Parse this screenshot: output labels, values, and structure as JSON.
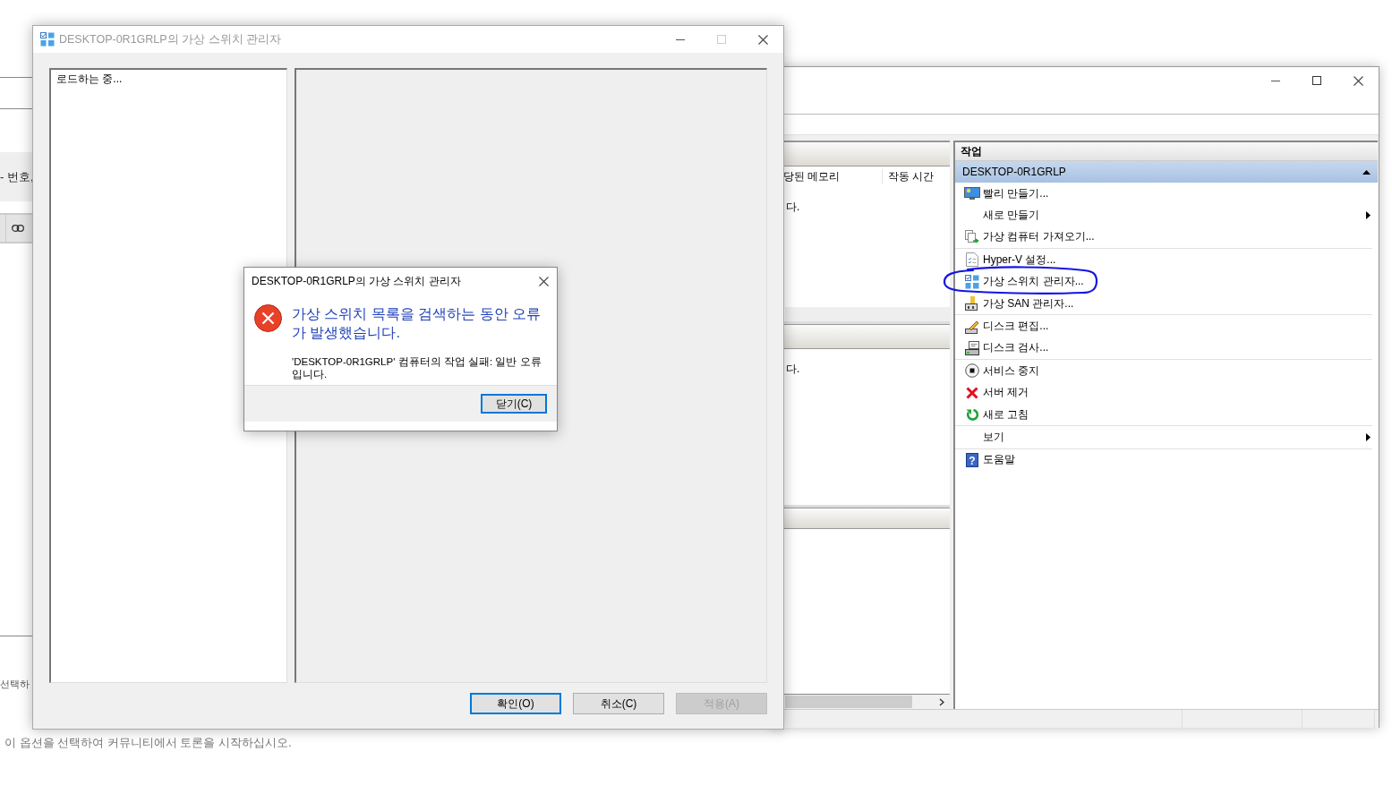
{
  "background_page": {
    "field_label": "- 번호,",
    "fragment": "선택하",
    "hint": "이 옵션을 선택하여 커뮤니티에서 토론을 시작하십시오."
  },
  "hyperv_window": {
    "center_pane": {
      "columns": [
        "당된 메모리",
        "작동 시간"
      ],
      "messages": [
        "다.",
        "다."
      ]
    },
    "actions": {
      "title": "작업",
      "group": {
        "label": "DESKTOP-0R1GRLP",
        "expanded": true
      },
      "items": [
        {
          "kind": "quick",
          "label": "빨리 만들기...",
          "submenu": false,
          "group_start": false,
          "circled": false
        },
        {
          "kind": "new",
          "label": "새로 만들기",
          "submenu": true,
          "group_start": false,
          "circled": false
        },
        {
          "kind": "import",
          "label": "가상 컴퓨터 가져오기...",
          "submenu": false,
          "group_start": false,
          "circled": false
        },
        {
          "kind": "settings",
          "label": "Hyper-V 설정...",
          "submenu": false,
          "group_start": true,
          "circled": false
        },
        {
          "kind": "switch",
          "label": "가상 스위치 관리자...",
          "submenu": false,
          "group_start": false,
          "circled": true
        },
        {
          "kind": "san",
          "label": "가상 SAN 관리자...",
          "submenu": false,
          "group_start": false,
          "circled": false
        },
        {
          "kind": "edit",
          "label": "디스크 편집...",
          "submenu": false,
          "group_start": true,
          "circled": false
        },
        {
          "kind": "inspect",
          "label": "디스크 검사...",
          "submenu": false,
          "group_start": false,
          "circled": false
        },
        {
          "kind": "stop",
          "label": "서비스 중지",
          "submenu": false,
          "group_start": true,
          "circled": false
        },
        {
          "kind": "remove",
          "label": "서버 제거",
          "submenu": false,
          "group_start": false,
          "circled": false
        },
        {
          "kind": "refresh",
          "label": "새로 고침",
          "submenu": false,
          "group_start": false,
          "circled": false
        },
        {
          "kind": "view",
          "label": "보기",
          "submenu": true,
          "group_start": true,
          "circled": false
        },
        {
          "kind": "help",
          "glyph": "?",
          "label": "도움말",
          "submenu": false,
          "group_start": true,
          "circled": false
        }
      ]
    }
  },
  "switch_manager": {
    "title": "DESKTOP-0R1GRLP의 가상 스위치 관리자",
    "active": false,
    "maximize_disabled": true,
    "list_status": "로드하는 중...",
    "buttons": [
      {
        "label": "확인(O)",
        "default": true,
        "disabled": false
      },
      {
        "label": "취소(C)",
        "default": false,
        "disabled": false
      },
      {
        "label": "적용(A)",
        "default": false,
        "disabled": true
      }
    ]
  },
  "error_dialog": {
    "title": "DESKTOP-0R1GRLP의 가상 스위치 관리자",
    "heading": "가상 스위치 목록을 검색하는 동안 오류가 발생했습니다.",
    "message": "'DESKTOP-0R1GRLP' 컴퓨터의 작업 실패: 일반 오류입니다.",
    "buttons": [
      {
        "label": "닫기(C)",
        "focused": true
      }
    ]
  }
}
